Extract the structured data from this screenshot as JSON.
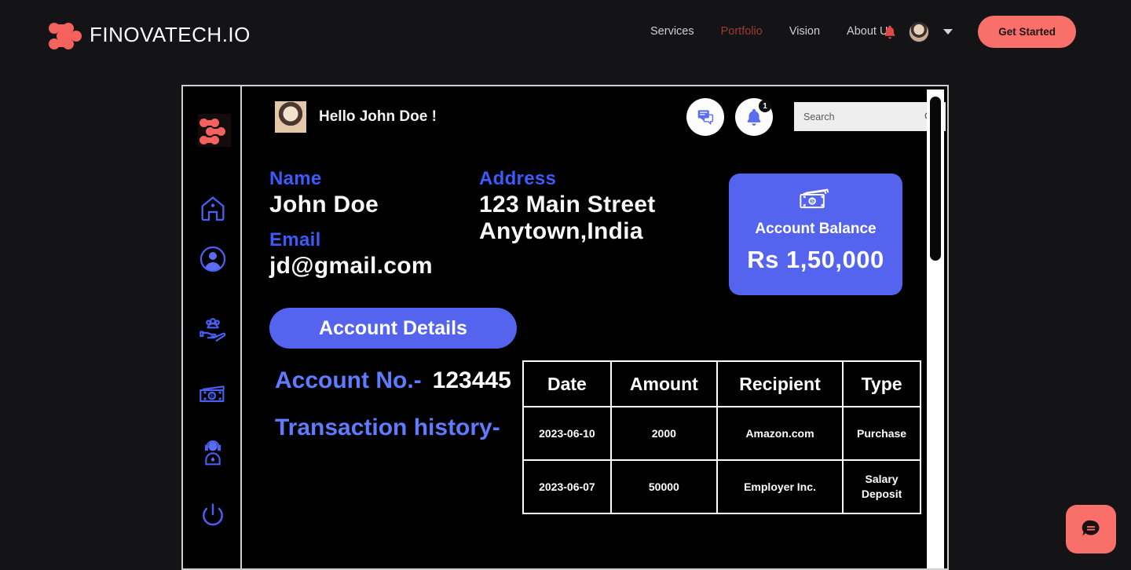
{
  "header": {
    "brand_name": "FINOVATECH.IO",
    "logo_icon": "finovatech-logo-icon",
    "nav": [
      {
        "label": "Services",
        "active": false
      },
      {
        "label": "Portfolio",
        "active": true
      },
      {
        "label": "Vision",
        "active": false
      },
      {
        "label": "About Us",
        "active": false
      }
    ],
    "bell_icon": "bell-icon",
    "avatar_icon": "user-avatar",
    "chevron_icon": "chevron-down-icon",
    "cta_label": "Get Started",
    "accent_color": "#f9706b",
    "active_nav_color": "#9c3a35"
  },
  "dashboard": {
    "sidebar": {
      "logo_icon": "finovatech-logo-icon",
      "items": [
        {
          "icon": "home-icon",
          "name": "home"
        },
        {
          "icon": "user-circle-icon",
          "name": "profile"
        },
        {
          "icon": "hand-holding-people-icon",
          "name": "clients"
        },
        {
          "icon": "cash-stack-icon",
          "name": "payments"
        },
        {
          "icon": "support-headset-icon",
          "name": "support"
        },
        {
          "icon": "power-icon",
          "name": "logout"
        }
      ]
    },
    "topbar": {
      "greeting": "Hello John Doe !",
      "avatar_icon": "user-photo",
      "chat_icon": "chat-bubbles-icon",
      "bell_icon": "bell-icon",
      "bell_badge": "1",
      "search_placeholder": "Search",
      "search_value": "",
      "search_icon": "search-icon"
    },
    "profile": {
      "name_label": "Name",
      "name_value": "John Doe",
      "email_label": "Email",
      "email_value": "jd@gmail.com",
      "address_label": "Address",
      "address_line1": "123 Main Street",
      "address_line2": "Anytown,India"
    },
    "balance_card": {
      "icon": "money-bills-icon",
      "title": "Account Balance",
      "amount": "Rs 1,50,000",
      "color": "#5564ef"
    },
    "account_details_button": "Account Details",
    "account_no_label": "Account No.-",
    "account_no_value": "123445",
    "transaction_history_label": "Transaction history-",
    "transactions": {
      "columns": [
        "Date",
        "Amount",
        "Recipient",
        "Type"
      ],
      "rows": [
        [
          "2023-06-10",
          "2000",
          "Amazon.com",
          "Purchase"
        ],
        [
          "2023-06-07",
          "50000",
          "Employer Inc.",
          "Salary\nDeposit"
        ]
      ]
    },
    "scroll_down_icon": "arrow-down-icon",
    "scrollbar": "vertical-scrollbar"
  },
  "chat_widget": {
    "icon": "chat-bubble-icon",
    "color": "#f9706b"
  }
}
